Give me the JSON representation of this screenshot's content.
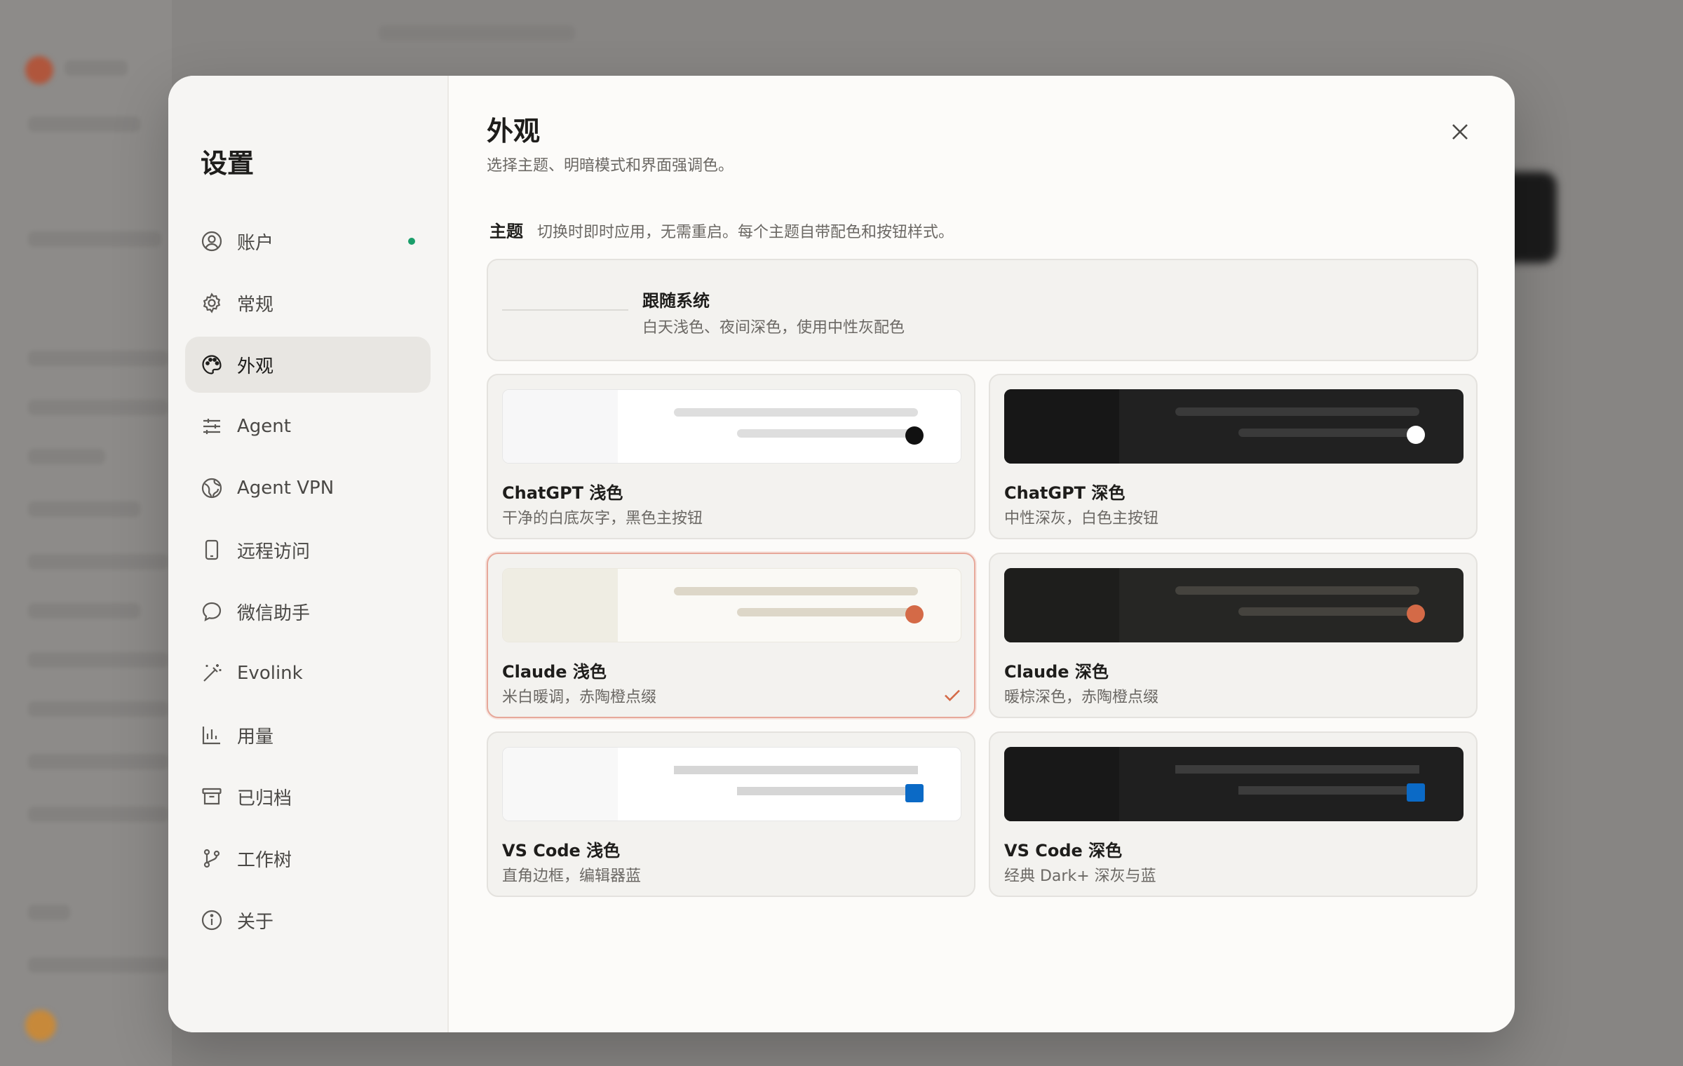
{
  "settings": {
    "title": "设置",
    "nav": [
      {
        "label": "账户",
        "icon": "user-circle-icon"
      },
      {
        "label": "常规",
        "icon": "gear-icon"
      },
      {
        "label": "外观",
        "icon": "palette-icon"
      },
      {
        "label": "Agent",
        "icon": "sliders-icon"
      },
      {
        "label": "Agent VPN",
        "icon": "globe-icon"
      },
      {
        "label": "远程访问",
        "icon": "phone-icon"
      },
      {
        "label": "微信助手",
        "icon": "chat-bubble-icon"
      },
      {
        "label": "Evolink",
        "icon": "magic-wand-icon"
      },
      {
        "label": "用量",
        "icon": "bar-chart-icon"
      },
      {
        "label": "已归档",
        "icon": "archive-icon"
      },
      {
        "label": "工作树",
        "icon": "git-branch-icon"
      },
      {
        "label": "关于",
        "icon": "info-icon"
      }
    ],
    "active": "外观"
  },
  "appearance": {
    "title": "外观",
    "subtitle": "选择主题、明暗模式和界面强调色。",
    "section": {
      "heading": "主题",
      "description": "切换时即时应用，无需重启。每个主题自带配色和按钮样式。"
    },
    "follow_system": {
      "name": "跟随系统",
      "desc": "白天浅色、夜间深色，使用中性灰配色"
    },
    "themes": [
      {
        "name": "ChatGPT 浅色",
        "desc": "干净的白底灰字，黑色主按钮",
        "selected": false
      },
      {
        "name": "ChatGPT 深色",
        "desc": "中性深灰，白色主按钮",
        "selected": false
      },
      {
        "name": "Claude 浅色",
        "desc": "米白暖调，赤陶橙点缀",
        "selected": true
      },
      {
        "name": "Claude 深色",
        "desc": "暖棕深色，赤陶橙点缀",
        "selected": false
      },
      {
        "name": "VS Code 浅色",
        "desc": "直角边框，编辑器蓝",
        "selected": false
      },
      {
        "name": "VS Code 深色",
        "desc": "经典 Dark+ 深灰与蓝",
        "selected": false
      }
    ]
  },
  "colors": {
    "accent": "#d46a47",
    "selected_border": "#e7a89a",
    "status_green": "#1a9e6a",
    "vscode_blue": "#0b6ac6"
  }
}
